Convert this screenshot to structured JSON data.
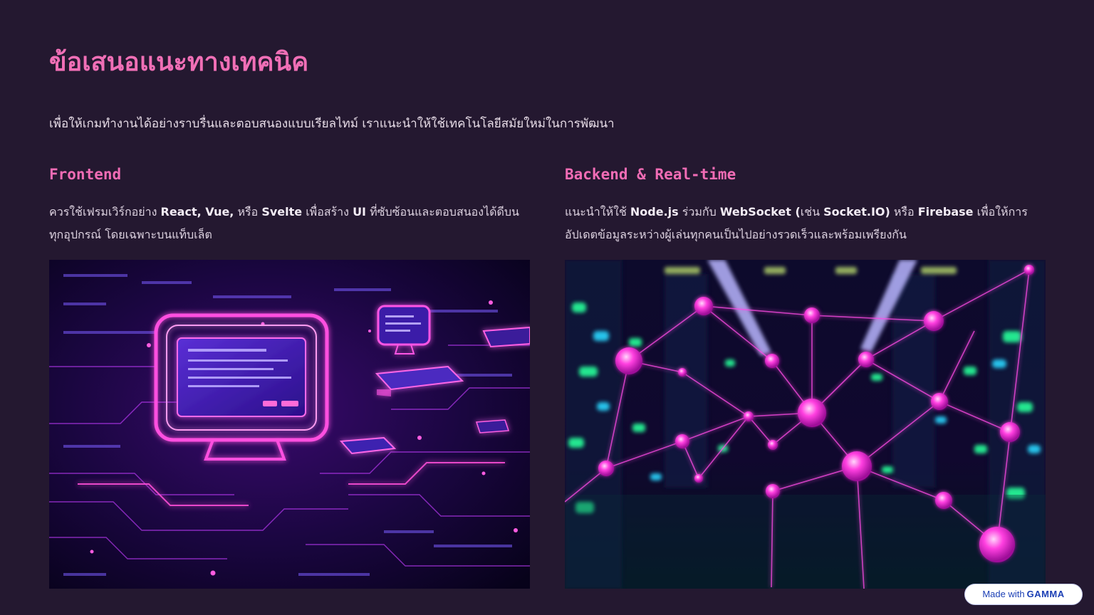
{
  "slide": {
    "title": "ข้อเสนอแนะทางเทคนิค",
    "intro": "เพื่อให้เกมทำงานได้อย่างราบรื่นและตอบสนองแบบเรียลไทม์ เราแนะนำให้ใช้เทคโนโลยีสมัยใหม่ในการพัฒนา"
  },
  "columns": [
    {
      "heading": "Frontend",
      "body": [
        {
          "text": "ควรใช้เฟรมเวิร์กอย่าง ",
          "bold": false
        },
        {
          "text": "React, Vue,",
          "bold": true
        },
        {
          "text": " หรือ ",
          "bold": false
        },
        {
          "text": "Svelte",
          "bold": true
        },
        {
          "text": " เพื่อสร้าง ",
          "bold": false
        },
        {
          "text": "UI",
          "bold": true
        },
        {
          "text": " ที่ซับซ้อนและตอบสนองได้ดีบนทุกอุปกรณ์ โดยเฉพาะบนแท็บเล็ต",
          "bold": false
        }
      ],
      "image": "neon-computer-screens-circuit-illustration"
    },
    {
      "heading": "Backend & Real-time",
      "body": [
        {
          "text": "แนะนำให้ใช้ ",
          "bold": false
        },
        {
          "text": "Node.js",
          "bold": true
        },
        {
          "text": " ร่วมกับ ",
          "bold": false
        },
        {
          "text": "WebSocket (",
          "bold": true
        },
        {
          "text": "เช่น ",
          "bold": false
        },
        {
          "text": "Socket.IO)",
          "bold": true
        },
        {
          "text": " หรือ ",
          "bold": false
        },
        {
          "text": "Firebase",
          "bold": true
        },
        {
          "text": " เพื่อให้การอัปเดตข้อมูลระหว่างผู้เล่นทุกคนเป็นไปอย่างรวดเร็วและพร้อมเพรียงกัน",
          "bold": false
        }
      ],
      "image": "neon-network-nodes-server-room-photo"
    }
  ],
  "badge": {
    "prefix": "Made with",
    "brand": "GAMMA"
  },
  "colors": {
    "background": "#241830",
    "accent": "#f06fb6",
    "text": "#e8dde8"
  }
}
